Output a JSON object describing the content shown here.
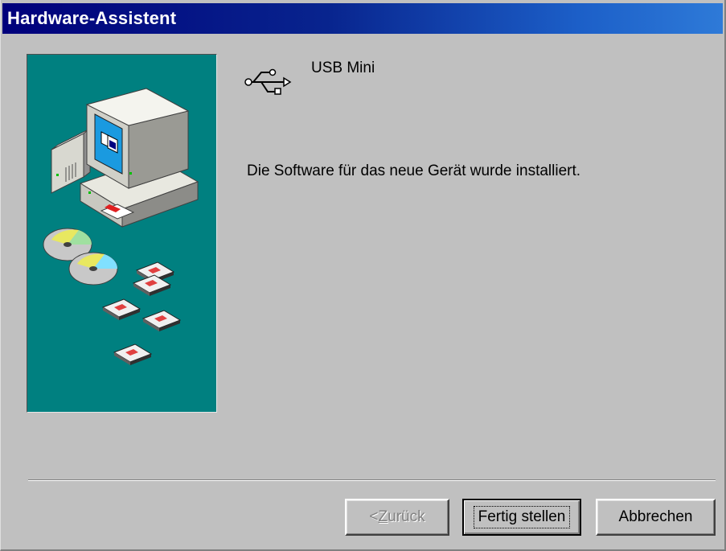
{
  "window": {
    "title": "Hardware-Assistent"
  },
  "device": {
    "icon": "usb-icon",
    "name": "USB Mini"
  },
  "message": "Die Software für das neue Gerät wurde installiert.",
  "buttons": {
    "back_prefix": "< ",
    "back_mnemonic": "Z",
    "back_rest": "urück",
    "back_enabled": false,
    "finish_label": "Fertig stellen",
    "cancel_label": "Abbrechen"
  },
  "colors": {
    "title_gradient_start": "#00007b",
    "title_gradient_end": "#2e7ad8",
    "illustration_bg": "#008080",
    "dialog_bg": "#c0c0c0"
  }
}
